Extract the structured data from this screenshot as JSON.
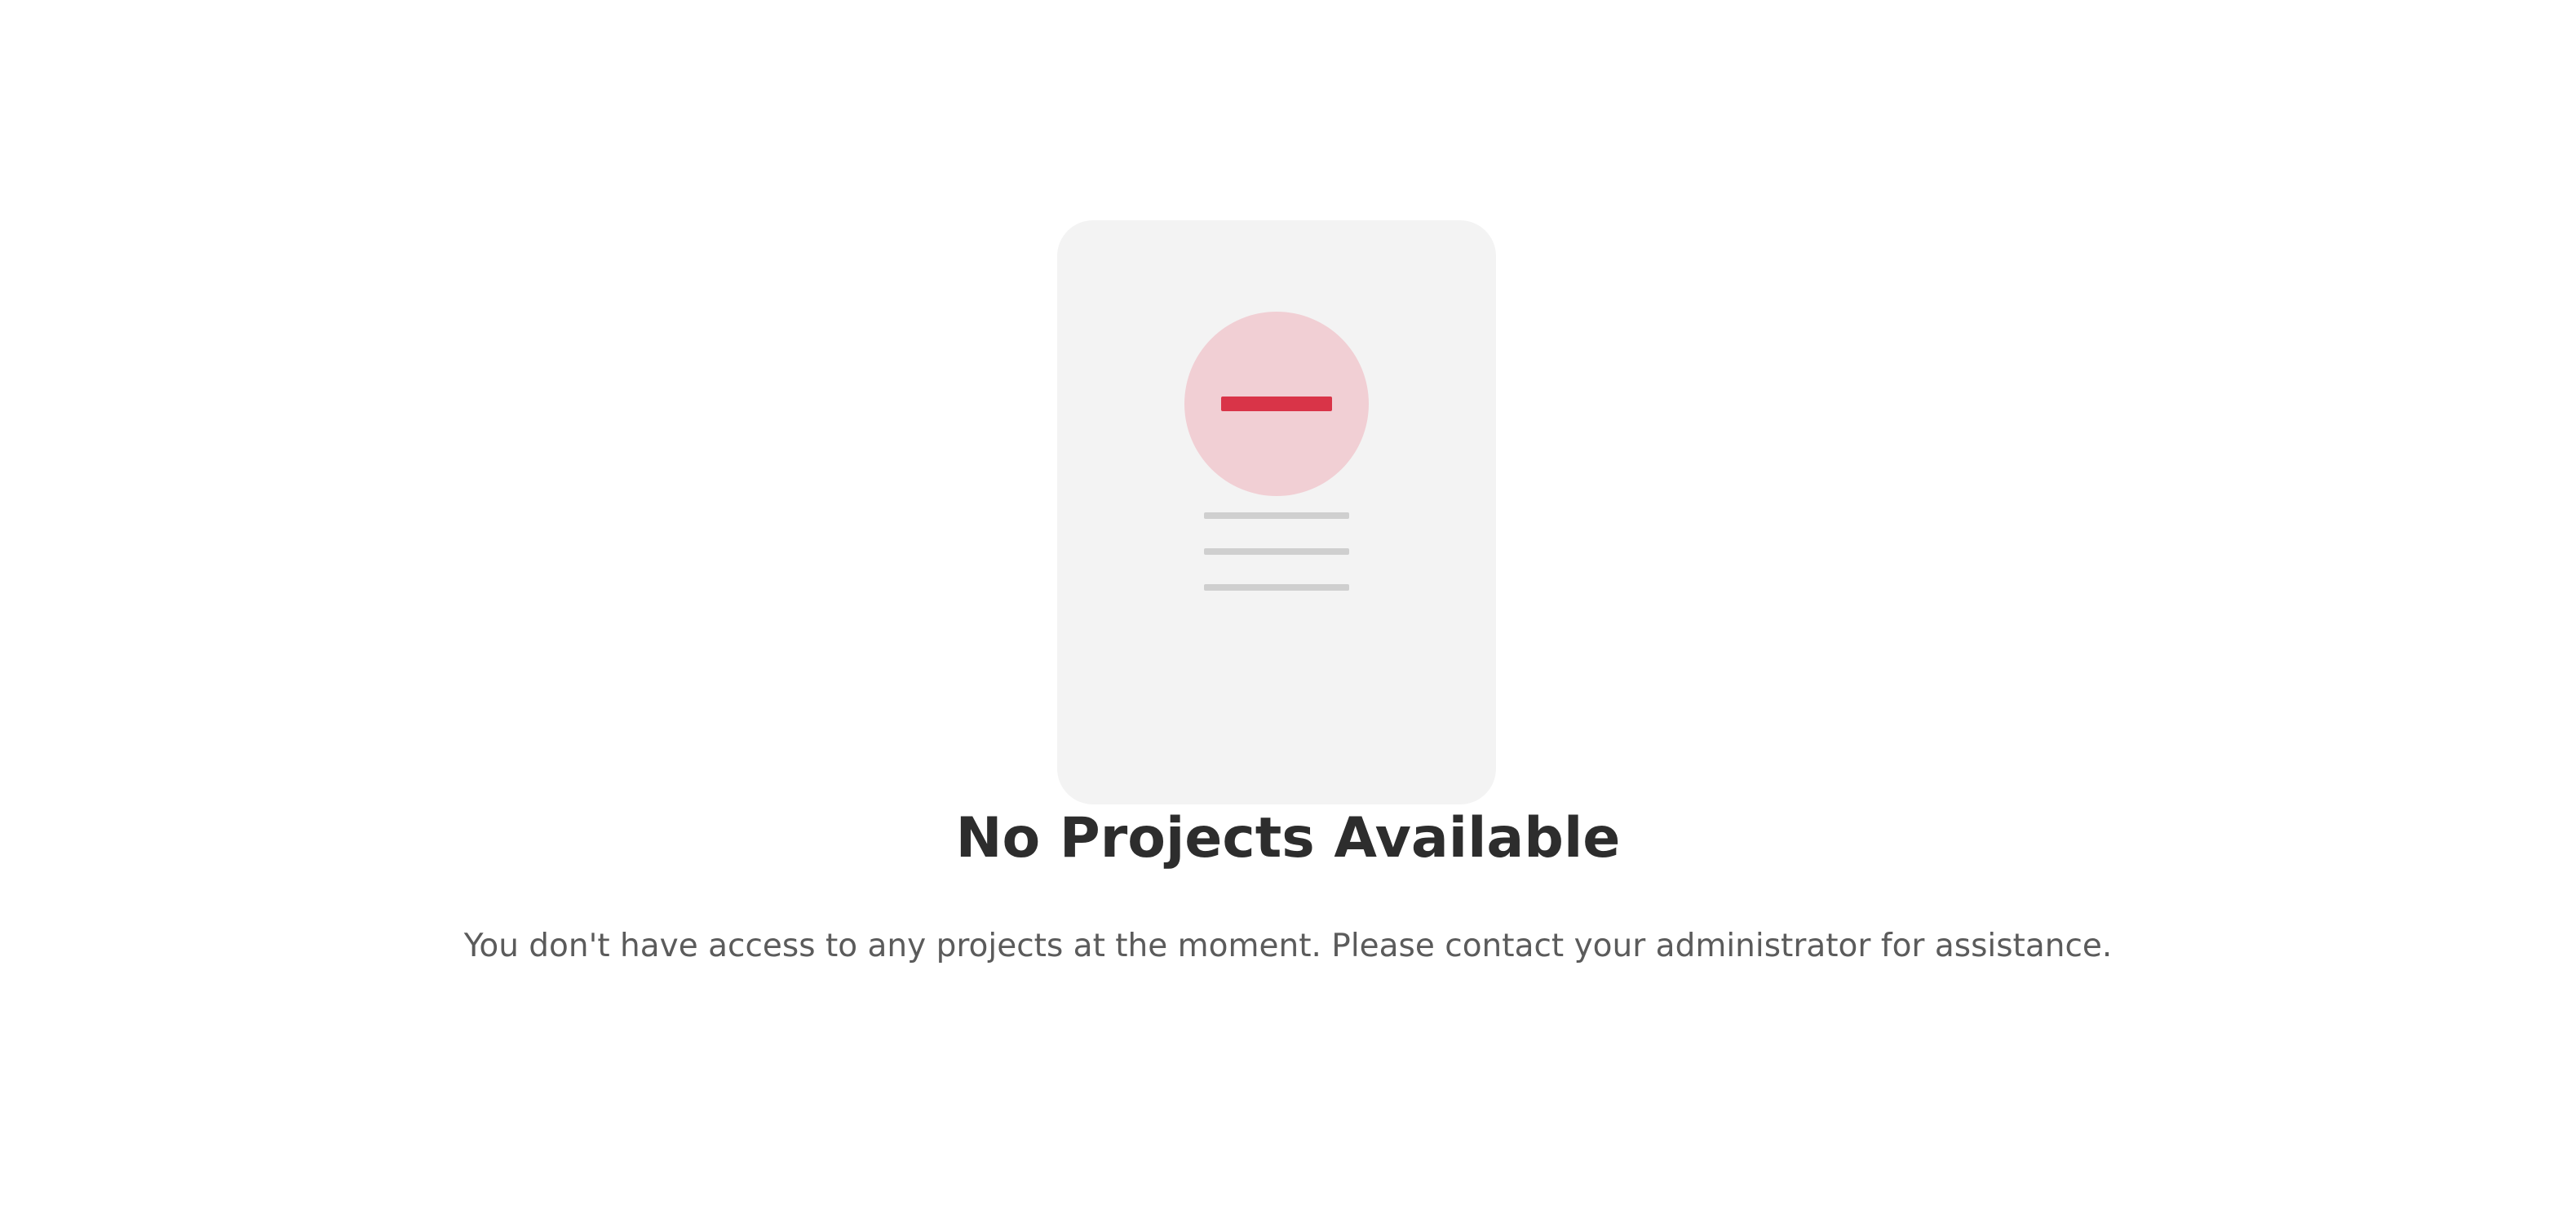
{
  "empty_state": {
    "title": "No Projects Available",
    "message": "You don't have access to any projects at the moment. Please contact your administrator for assistance.",
    "illustration": {
      "icon": "minus-circle-icon",
      "accent_color": "#d93448",
      "circle_color": "#f1cfd4",
      "card_color": "#f3f3f3",
      "line_color": "#cfcfcf"
    }
  }
}
